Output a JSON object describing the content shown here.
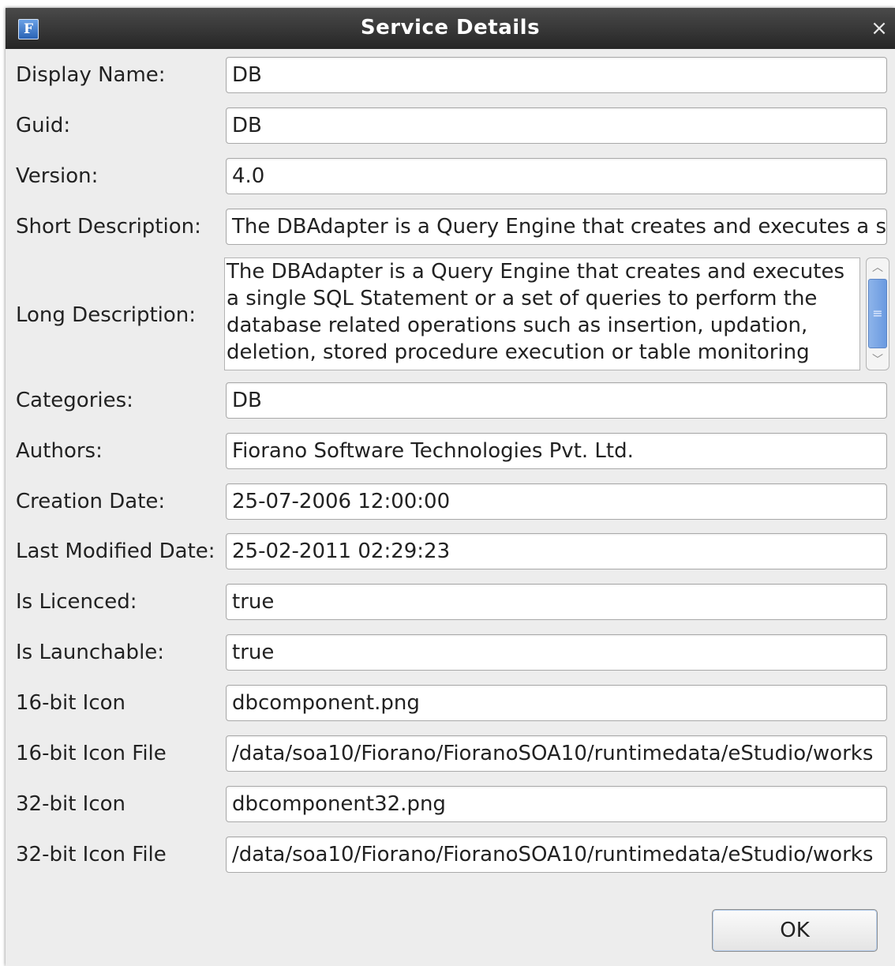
{
  "window": {
    "title": "Service Details",
    "app_icon": "F",
    "close_glyph": "×"
  },
  "fields": {
    "display_name": {
      "label": "Display Name:",
      "value": "DB"
    },
    "guid": {
      "label": "Guid:",
      "value": "DB"
    },
    "version": {
      "label": "Version:",
      "value": "4.0"
    },
    "short_description": {
      "label": "Short Description:",
      "value": "The DBAdapter is a Query Engine that creates and executes a s"
    },
    "long_description": {
      "label": "Long Description:",
      "lines": [
        "The DBAdapter is a Query Engine that creates and executes",
        "a single SQL Statement or a set of queries to perform the",
        "database related operations such as insertion, updation,",
        "deletion, stored procedure execution or table monitoring"
      ]
    },
    "categories": {
      "label": "Categories:",
      "value": "DB"
    },
    "authors": {
      "label": "Authors:",
      "value": "Fiorano Software Technologies Pvt. Ltd."
    },
    "creation_date": {
      "label": "Creation Date:",
      "value": "25-07-2006 12:00:00"
    },
    "last_modified_date": {
      "label": "Last Modified Date:",
      "value": "25-02-2011 02:29:23"
    },
    "is_licenced": {
      "label": "Is Licenced:",
      "value": "true"
    },
    "is_launchable": {
      "label": "Is Launchable:",
      "value": "true"
    },
    "icon_16": {
      "label": "16-bit Icon",
      "value": "dbcomponent.png"
    },
    "icon_16_file": {
      "label": "16-bit Icon File",
      "value": "/data/soa10/Fiorano/FioranoSOA10/runtimedata/eStudio/works"
    },
    "icon_32": {
      "label": "32-bit Icon",
      "value": "dbcomponent32.png"
    },
    "icon_32_file": {
      "label": "32-bit Icon File",
      "value": "/data/soa10/Fiorano/FioranoSOA10/runtimedata/eStudio/works"
    }
  },
  "scrollbar": {
    "up_glyph": "︿",
    "down_glyph": "﹀",
    "thumb_glyph": "≡"
  },
  "buttons": {
    "ok_label": "OK"
  }
}
